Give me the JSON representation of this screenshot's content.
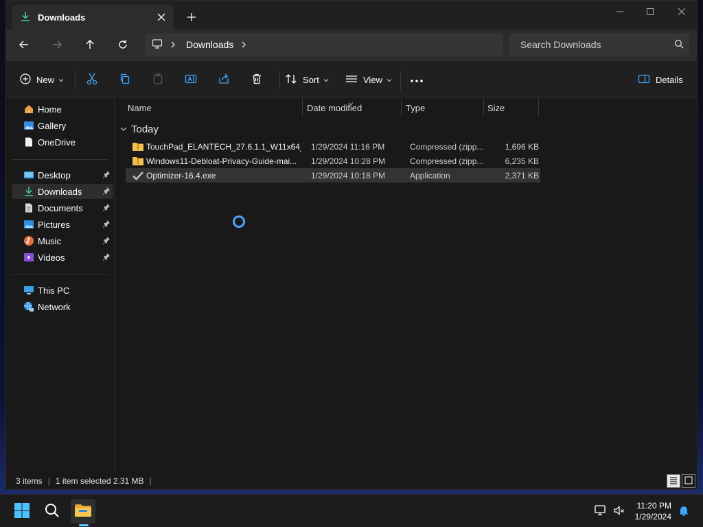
{
  "window": {
    "tab_title": "Downloads",
    "icons": {
      "tab": "download-icon",
      "close": "close-icon",
      "new_tab": "plus-icon"
    }
  },
  "address": {
    "crumbs": [
      "Downloads"
    ],
    "search_placeholder": "Search Downloads"
  },
  "toolbar": {
    "new_label": "New",
    "sort_label": "Sort",
    "view_label": "View",
    "details_label": "Details"
  },
  "sidebar": {
    "items": [
      {
        "label": "Home",
        "icon": "home-icon"
      },
      {
        "label": "Gallery",
        "icon": "gallery-icon"
      },
      {
        "label": "OneDrive",
        "icon": "onedrive-icon"
      },
      {
        "label": "Desktop",
        "icon": "desktop-icon",
        "pinned": true
      },
      {
        "label": "Downloads",
        "icon": "download-icon",
        "pinned": true,
        "selected": true
      },
      {
        "label": "Documents",
        "icon": "documents-icon",
        "pinned": true
      },
      {
        "label": "Pictures",
        "icon": "pictures-icon",
        "pinned": true
      },
      {
        "label": "Music",
        "icon": "music-icon",
        "pinned": true
      },
      {
        "label": "Videos",
        "icon": "videos-icon",
        "pinned": true
      },
      {
        "label": "This PC",
        "icon": "this-pc-icon"
      },
      {
        "label": "Network",
        "icon": "network-icon"
      }
    ]
  },
  "columns": {
    "name": "Name",
    "date": "Date modified",
    "type": "Type",
    "size": "Size"
  },
  "group": {
    "label": "Today"
  },
  "files": [
    {
      "name": "TouchPad_ELANTECH_27.6.1.1_W11x64_...",
      "date": "1/29/2024 11:16 PM",
      "type": "Compressed (zipp...",
      "size": "1,696 KB",
      "icon": "zip-folder-icon"
    },
    {
      "name": "Windows11-Debloat-Privacy-Guide-mai...",
      "date": "1/29/2024 10:28 PM",
      "type": "Compressed (zipp...",
      "size": "6,235 KB",
      "icon": "zip-folder-icon"
    },
    {
      "name": "Optimizer-16.4.exe",
      "date": "1/29/2024 10:18 PM",
      "type": "Application",
      "size": "2,371 KB",
      "icon": "checkmark-app-icon",
      "selected": true
    }
  ],
  "status": {
    "items_count": "3 items",
    "selection": "1 item selected  2.31 MB"
  },
  "taskbar": {
    "time": "11:20 PM",
    "date": "1/29/2024"
  },
  "colors": {
    "accent": "#60cdff",
    "folder": "#f2c14e",
    "selection": "#333333"
  }
}
